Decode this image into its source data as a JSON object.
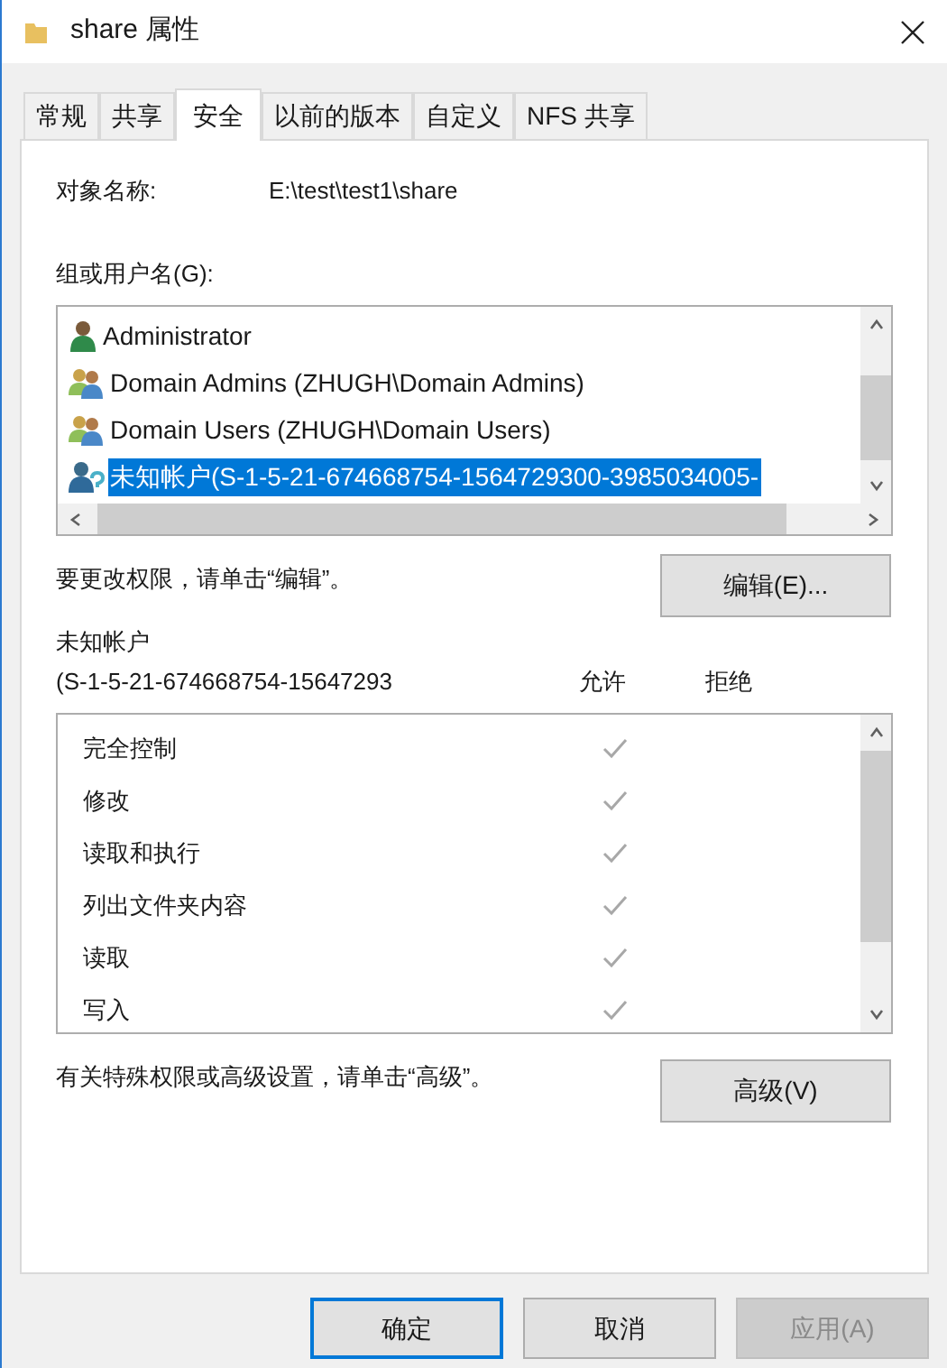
{
  "window": {
    "title": "share 属性"
  },
  "tabs": [
    {
      "label": "常规",
      "selected": false
    },
    {
      "label": "共享",
      "selected": false
    },
    {
      "label": "安全",
      "selected": true
    },
    {
      "label": "以前的版本",
      "selected": false
    },
    {
      "label": "自定义",
      "selected": false
    },
    {
      "label": "NFS 共享",
      "selected": false
    }
  ],
  "object_name": {
    "label": "对象名称:",
    "value": "E:\\test\\test1\\share"
  },
  "groups": {
    "label": "组或用户名(G):",
    "items": [
      {
        "name": "Administrator",
        "kind": "user",
        "selected": false
      },
      {
        "name": "Domain Admins (ZHUGH\\Domain Admins)",
        "kind": "group",
        "selected": false
      },
      {
        "name": "Domain Users (ZHUGH\\Domain Users)",
        "kind": "group",
        "selected": false
      },
      {
        "name": "未知帐户(S-1-5-21-674668754-1564729300-3985034005-",
        "kind": "unknown",
        "selected": true
      }
    ]
  },
  "edit_hint": "要更改权限，请单击“编辑”。",
  "edit_button": "编辑(E)...",
  "permissions": {
    "account": "未知帐户",
    "account_sid": "(S-1-5-21-674668754-15647293",
    "allow_header": "允许",
    "deny_header": "拒绝",
    "rows": [
      {
        "name": "完全控制",
        "allow": true
      },
      {
        "name": "修改",
        "allow": true
      },
      {
        "name": "读取和执行",
        "allow": true
      },
      {
        "name": "列出文件夹内容",
        "allow": true
      },
      {
        "name": "读取",
        "allow": true
      },
      {
        "name": "写入",
        "allow": true
      }
    ]
  },
  "advanced_hint": "有关特殊权限或高级设置，请单击“高级”。",
  "advanced_button": "高级(V)",
  "buttons": [
    {
      "label": "确定",
      "kind": "default",
      "disabled": false
    },
    {
      "label": "取消",
      "kind": "normal",
      "disabled": false
    },
    {
      "label": "应用(A)",
      "kind": "normal",
      "disabled": true
    }
  ]
}
